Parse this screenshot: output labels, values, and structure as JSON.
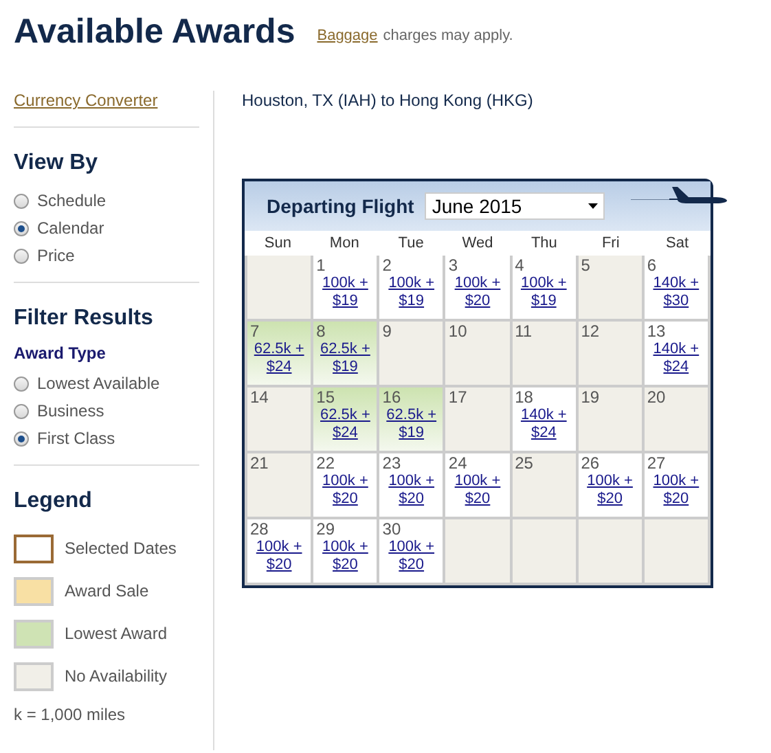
{
  "title": "Available Awards",
  "notice": {
    "link": "Baggage",
    "text": "charges may apply."
  },
  "currency_link": "Currency Converter",
  "route": "Houston, TX (IAH) to Hong Kong (HKG)",
  "view_by": {
    "heading": "View By",
    "options": [
      {
        "label": "Schedule",
        "selected": false
      },
      {
        "label": "Calendar",
        "selected": true
      },
      {
        "label": "Price",
        "selected": false
      }
    ]
  },
  "filter": {
    "heading": "Filter Results",
    "subheading": "Award Type",
    "options": [
      {
        "label": "Lowest Available",
        "selected": false
      },
      {
        "label": "Business",
        "selected": false
      },
      {
        "label": "First Class",
        "selected": true
      }
    ]
  },
  "legend": {
    "heading": "Legend",
    "items": [
      {
        "kind": "selected",
        "label": "Selected Dates"
      },
      {
        "kind": "sale",
        "label": "Award Sale"
      },
      {
        "kind": "lowest",
        "label": "Lowest Award"
      },
      {
        "kind": "none",
        "label": "No Availability"
      }
    ],
    "note": "k = 1,000 miles"
  },
  "calendar": {
    "heading": "Departing Flight",
    "month": "June 2015",
    "weekdays": [
      "Sun",
      "Mon",
      "Tue",
      "Wed",
      "Thu",
      "Fri",
      "Sat"
    ],
    "days": [
      {
        "kind": "blank"
      },
      {
        "kind": "available",
        "day": "1",
        "award": "100k + $19"
      },
      {
        "kind": "available",
        "day": "2",
        "award": "100k + $19"
      },
      {
        "kind": "available",
        "day": "3",
        "award": "100k + $20"
      },
      {
        "kind": "available",
        "day": "4",
        "award": "100k + $19"
      },
      {
        "kind": "none",
        "day": "5"
      },
      {
        "kind": "available",
        "day": "6",
        "award": "140k + $30"
      },
      {
        "kind": "lowest",
        "day": "7",
        "award": "62.5k + $24"
      },
      {
        "kind": "lowest",
        "day": "8",
        "award": "62.5k + $19"
      },
      {
        "kind": "none",
        "day": "9"
      },
      {
        "kind": "none",
        "day": "10"
      },
      {
        "kind": "none",
        "day": "11"
      },
      {
        "kind": "none",
        "day": "12"
      },
      {
        "kind": "available",
        "day": "13",
        "award": "140k + $24"
      },
      {
        "kind": "none",
        "day": "14"
      },
      {
        "kind": "lowest",
        "day": "15",
        "award": "62.5k + $24"
      },
      {
        "kind": "lowest",
        "day": "16",
        "award": "62.5k + $19"
      },
      {
        "kind": "none",
        "day": "17"
      },
      {
        "kind": "available",
        "day": "18",
        "award": "140k + $24"
      },
      {
        "kind": "none",
        "day": "19"
      },
      {
        "kind": "none",
        "day": "20"
      },
      {
        "kind": "none",
        "day": "21"
      },
      {
        "kind": "available",
        "day": "22",
        "award": "100k + $20"
      },
      {
        "kind": "available",
        "day": "23",
        "award": "100k + $20"
      },
      {
        "kind": "available",
        "day": "24",
        "award": "100k + $20"
      },
      {
        "kind": "none",
        "day": "25"
      },
      {
        "kind": "available",
        "day": "26",
        "award": "100k + $20"
      },
      {
        "kind": "available",
        "day": "27",
        "award": "100k + $20"
      },
      {
        "kind": "available",
        "day": "28",
        "award": "100k + $20"
      },
      {
        "kind": "available",
        "day": "29",
        "award": "100k + $20"
      },
      {
        "kind": "available",
        "day": "30",
        "award": "100k + $20"
      },
      {
        "kind": "blank"
      },
      {
        "kind": "blank"
      },
      {
        "kind": "blank"
      },
      {
        "kind": "blank"
      }
    ]
  }
}
